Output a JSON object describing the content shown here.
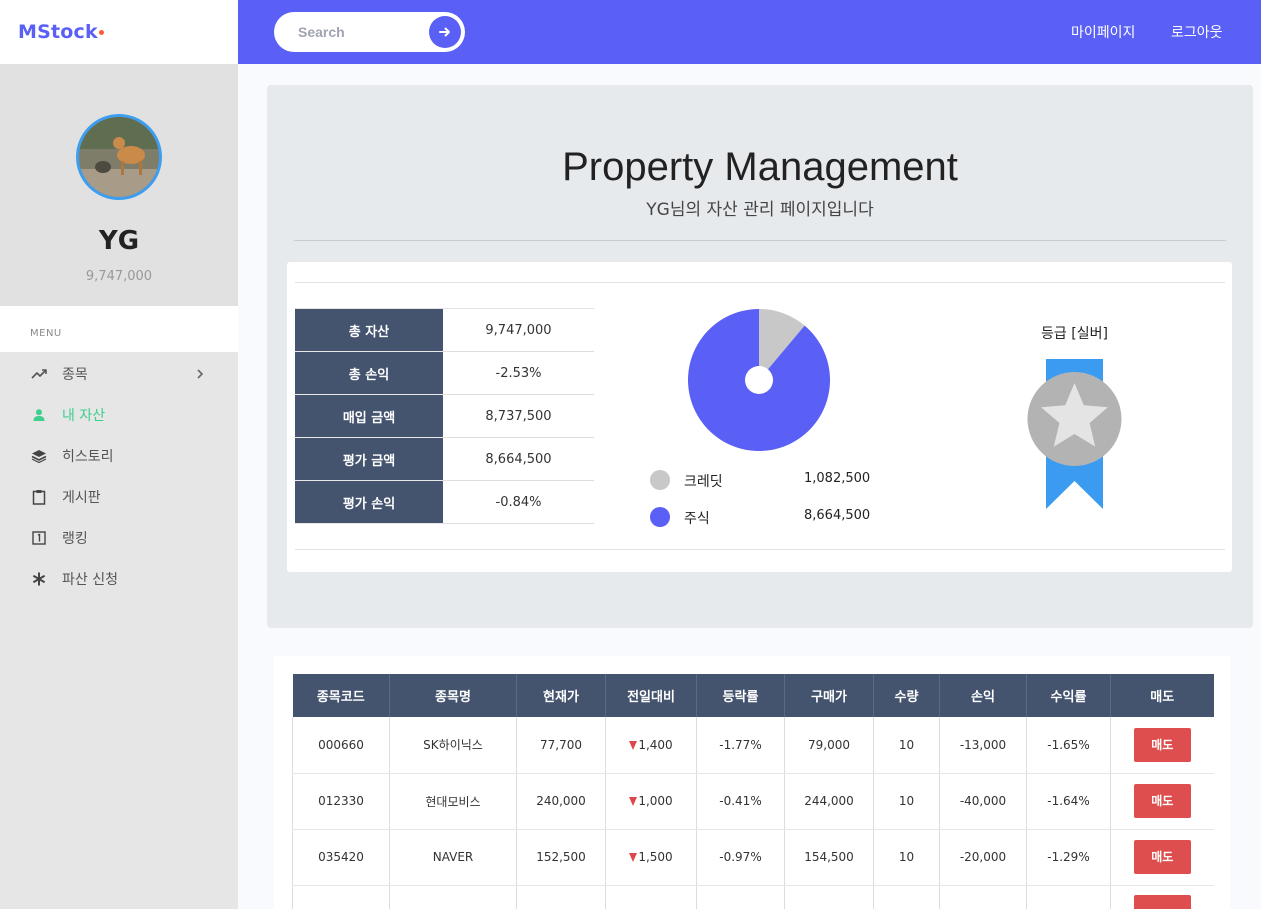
{
  "brand": {
    "name": "MStock",
    "dot_color": "#ff5b3a"
  },
  "colors": {
    "accent": "#5a5ff6",
    "table_header": "#44546f",
    "negative": "#e0474b",
    "active_menu": "#3ecf8e",
    "sell_button": "#de4e4e"
  },
  "topbar": {
    "search_placeholder": "Search",
    "search_icon": "arrow-right-icon",
    "links": [
      "마이페이지",
      "로그아웃"
    ]
  },
  "sidebar": {
    "profile": {
      "name": "YG",
      "balance": "9,747,000"
    },
    "menu_title": "MENU",
    "items": [
      {
        "label": "종목",
        "icon": "trending-up-icon",
        "has_chevron": true,
        "active": false
      },
      {
        "label": "내 자산",
        "icon": "user-icon",
        "has_chevron": false,
        "active": true
      },
      {
        "label": "히스토리",
        "icon": "layers-icon",
        "has_chevron": false,
        "active": false
      },
      {
        "label": "게시판",
        "icon": "clipboard-icon",
        "has_chevron": false,
        "active": false
      },
      {
        "label": "랭킹",
        "icon": "numbered-square-icon",
        "has_chevron": false,
        "active": false
      },
      {
        "label": "파산 신청",
        "icon": "asterisk-icon",
        "has_chevron": false,
        "active": false
      }
    ]
  },
  "main": {
    "title": "Property Management",
    "subtitle": "YG님의 자산 관리 페이지입니다",
    "summary": [
      {
        "label": "총 자산",
        "value": "9,747,000",
        "negative": false
      },
      {
        "label": "총 손익",
        "value": "-2.53%",
        "negative": true
      },
      {
        "label": "매입 금액",
        "value": "8,737,500",
        "negative": false
      },
      {
        "label": "평가 금액",
        "value": "8,664,500",
        "negative": false
      },
      {
        "label": "평가 손익",
        "value": "-0.84%",
        "negative": true
      }
    ],
    "pie": {
      "segments": [
        {
          "name": "크레딧",
          "value": 1082500,
          "display": "1,082,500",
          "color": "#c8c8c8"
        },
        {
          "name": "주식",
          "value": 8664500,
          "display": "8,664,500",
          "color": "#5a5ff6"
        }
      ]
    },
    "grade": {
      "label": "등급 [실버]",
      "medal_icon": "silver-star-medal-icon"
    }
  },
  "stocks": {
    "headers": [
      "종목코드",
      "종목명",
      "현재가",
      "전일대비",
      "등락률",
      "구매가",
      "수량",
      "손익",
      "수익률",
      "매도"
    ],
    "rows": [
      {
        "code": "000660",
        "name": "SK하이닉스",
        "price": "77,700",
        "change": "1,400",
        "rate": "-1.77%",
        "buy": "79,000",
        "qty": "10",
        "pl": "-13,000",
        "pl_rate": "-1.65%",
        "sell": "매도"
      },
      {
        "code": "012330",
        "name": "현대모비스",
        "price": "240,000",
        "change": "1,000",
        "rate": "-0.41%",
        "buy": "244,000",
        "qty": "10",
        "pl": "-40,000",
        "pl_rate": "-1.64%",
        "sell": "매도"
      },
      {
        "code": "035420",
        "name": "NAVER",
        "price": "152,500",
        "change": "1,500",
        "rate": "-0.97%",
        "buy": "154,500",
        "qty": "10",
        "pl": "-20,000",
        "pl_rate": "-1.29%",
        "sell": "매도"
      },
      {
        "code": "",
        "name": "",
        "price": "",
        "change": "",
        "rate": "",
        "buy": "",
        "qty": "",
        "pl": "",
        "pl_rate": "",
        "sell": ""
      }
    ]
  }
}
